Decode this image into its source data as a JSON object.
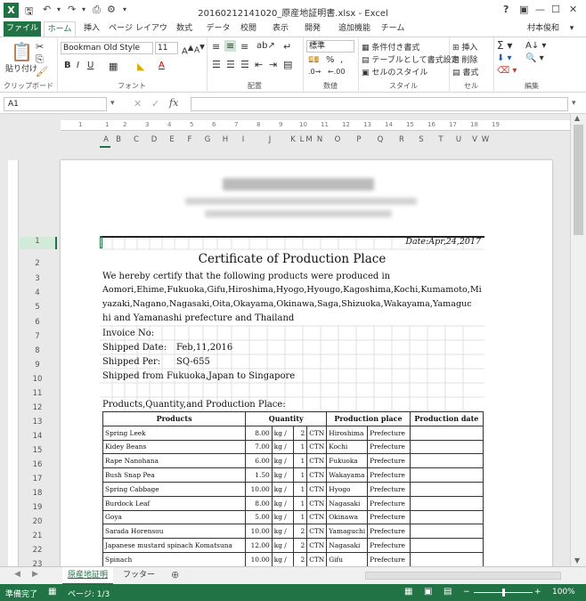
{
  "window": {
    "title": "20160212141020_原産地証明書.xlsx - Excel",
    "help": "?",
    "user": "村本俊和"
  },
  "ribbon_tabs": [
    "ファイル",
    "ホーム",
    "挿入",
    "ページ レイアウト",
    "数式",
    "データ",
    "校閲",
    "表示",
    "開発",
    "追加機能",
    "チーム"
  ],
  "ribbon": {
    "paste": "貼り付け",
    "clipboard": "クリップボード",
    "font_name": "Bookman Old Style",
    "font_size": "11",
    "font_group": "フォント",
    "align_group": "配置",
    "number_format": "標準",
    "number_group": "数値",
    "cond_format": "条件付き書式",
    "table_format": "テーブルとして書式設定",
    "cell_style": "セルのスタイル",
    "style_group": "スタイル",
    "insert": "挿入",
    "delete": "削除",
    "format": "書式",
    "cell_group": "セル",
    "edit_group": "編集"
  },
  "formula_bar": {
    "name_box": "A1",
    "fx": "fx",
    "value": ""
  },
  "columns": [
    "A",
    "B",
    "C",
    "D",
    "E",
    "F",
    "G",
    "H",
    "I",
    "J",
    "K",
    "L",
    "M",
    "N",
    "O",
    "P",
    "Q",
    "R",
    "S",
    "T",
    "U",
    "V",
    "W"
  ],
  "ruler_marks": [
    "1",
    "1",
    "2",
    "3",
    "4",
    "5",
    "6",
    "7",
    "8",
    "9",
    "10",
    "11",
    "12",
    "13",
    "14",
    "15",
    "16",
    "17",
    "18",
    "19"
  ],
  "rows": [
    "1",
    "2",
    "3",
    "4",
    "5",
    "6",
    "7",
    "8",
    "9",
    "10",
    "11",
    "12",
    "13",
    "14",
    "15",
    "16",
    "17",
    "18",
    "19",
    "20",
    "21",
    "22",
    "23"
  ],
  "certificate": {
    "date": "Date:Apr,24,2017",
    "title": "Certificate of Production Place",
    "body": [
      "We hereby certify that the following products were produced in",
      "Aomori,Ehime,Fukuoka,Gifu,Hiroshima,Hyogo,Hyougo,Kagoshima,Kochi,Kumamoto,Mi",
      "yazaki,Nagano,Nagasaki,Oita,Okayama,Okinawa,Saga,Shizuoka,Wakayama,Yamaguc",
      "hi and Yamanashi prefecture and Thailand"
    ],
    "invoice_label": "Invoice No:",
    "shipped_date_label": "Shipped Date:",
    "shipped_date": "Feb,11,2016",
    "shipped_per_label": "Shipped Per:",
    "shipped_per": "SQ-655",
    "shipped_from": "Shipped from Fukuoka,Japan to Singapore",
    "products_heading": "Products,Quantity,and Production Place:",
    "table_headers": [
      "Products",
      "Quantity",
      "Production place",
      "Production date"
    ],
    "products": [
      {
        "name": "Spring Leek",
        "qty": "8.00",
        "unit": "kg /",
        "cnt": "2",
        "ctn": "CTN",
        "place": "Hiroshima",
        "pref": "Prefecture"
      },
      {
        "name": "Kidey Beans",
        "qty": "7.00",
        "unit": "kg /",
        "cnt": "1",
        "ctn": "CTN",
        "place": "Kochi",
        "pref": "Prefecture"
      },
      {
        "name": "Rape Nanohana",
        "qty": "6.00",
        "unit": "kg /",
        "cnt": "1",
        "ctn": "CTN",
        "place": "Fukuoka",
        "pref": "Prefecture"
      },
      {
        "name": "Bush Snap Pea",
        "qty": "1.50",
        "unit": "kg /",
        "cnt": "1",
        "ctn": "CTN",
        "place": "Wakayama",
        "pref": "Prefecture"
      },
      {
        "name": "Spring Cabbage",
        "qty": "10.00",
        "unit": "kg /",
        "cnt": "1",
        "ctn": "CTN",
        "place": "Hyogo",
        "pref": "Prefecture"
      },
      {
        "name": "Burdock Leaf",
        "qty": "8.00",
        "unit": "kg /",
        "cnt": "1",
        "ctn": "CTN",
        "place": "Nagasaki",
        "pref": "Prefecture"
      },
      {
        "name": "Goya",
        "qty": "5.00",
        "unit": "kg /",
        "cnt": "1",
        "ctn": "CTN",
        "place": "Okinawa",
        "pref": "Prefecture"
      },
      {
        "name": "Sarada Horensou",
        "qty": "10.00",
        "unit": "kg /",
        "cnt": "2",
        "ctn": "CTN",
        "place": "Yamaguchi",
        "pref": "Prefecture"
      },
      {
        "name": "Japanese mustard spinach Komatsuna",
        "qty": "12.00",
        "unit": "kg /",
        "cnt": "2",
        "ctn": "CTN",
        "place": "Nagasaki",
        "pref": "Prefecture"
      },
      {
        "name": "Spinach",
        "qty": "10.00",
        "unit": "kg /",
        "cnt": "2",
        "ctn": "CTN",
        "place": "Gifu",
        "pref": "Prefecture"
      }
    ]
  },
  "sheet_tabs": [
    "原産地証明",
    "フッター"
  ],
  "status": {
    "ready": "準備完了",
    "page": "ページ: 1/3",
    "zoom": "100%"
  },
  "colors": {
    "accent": "#217346"
  }
}
